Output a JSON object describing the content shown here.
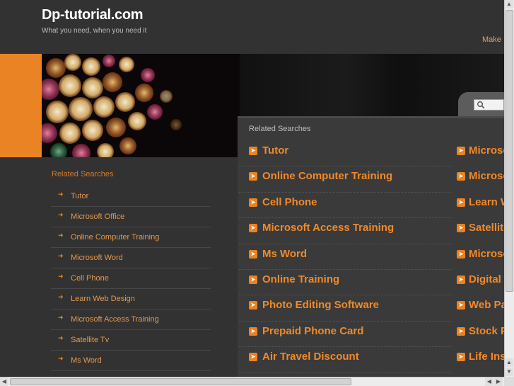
{
  "header": {
    "title": "Dp-tutorial.com",
    "tagline": "What you need, when you need it",
    "make_text": "Make"
  },
  "search": {
    "placeholder": ""
  },
  "sidebar": {
    "heading": "Related Searches",
    "items": [
      {
        "label": "Tutor"
      },
      {
        "label": "Microsoft Office"
      },
      {
        "label": "Online Computer Training"
      },
      {
        "label": "Microsoft Word"
      },
      {
        "label": "Cell Phone"
      },
      {
        "label": "Learn Web Design"
      },
      {
        "label": "Microsoft Access Training"
      },
      {
        "label": "Satellite Tv"
      },
      {
        "label": "Ms Word"
      }
    ]
  },
  "main": {
    "heading": "Related Searches",
    "left_items": [
      {
        "label": "Tutor"
      },
      {
        "label": "Online Computer Training"
      },
      {
        "label": "Cell Phone"
      },
      {
        "label": "Microsoft Access Training"
      },
      {
        "label": "Ms Word"
      },
      {
        "label": "Online Training"
      },
      {
        "label": "Photo Editing Software"
      },
      {
        "label": "Prepaid Phone Card"
      },
      {
        "label": "Air Travel Discount"
      }
    ],
    "right_items": [
      {
        "label": "Microsoft Office"
      },
      {
        "label": "Microsoft Word"
      },
      {
        "label": "Learn Web Design"
      },
      {
        "label": "Satellite Tv"
      },
      {
        "label": "Microsoft"
      },
      {
        "label": "Digital P"
      },
      {
        "label": "Web Pa"
      },
      {
        "label": "Stock P"
      },
      {
        "label": "Life Ins"
      }
    ]
  },
  "colors": {
    "accent": "#e98324",
    "link": "#f08a2a",
    "background": "#2e2e2e",
    "panel": "#3a3a3a"
  },
  "icons": {
    "bullet": "orange-arrow-icon",
    "search": "magnifier-icon"
  }
}
